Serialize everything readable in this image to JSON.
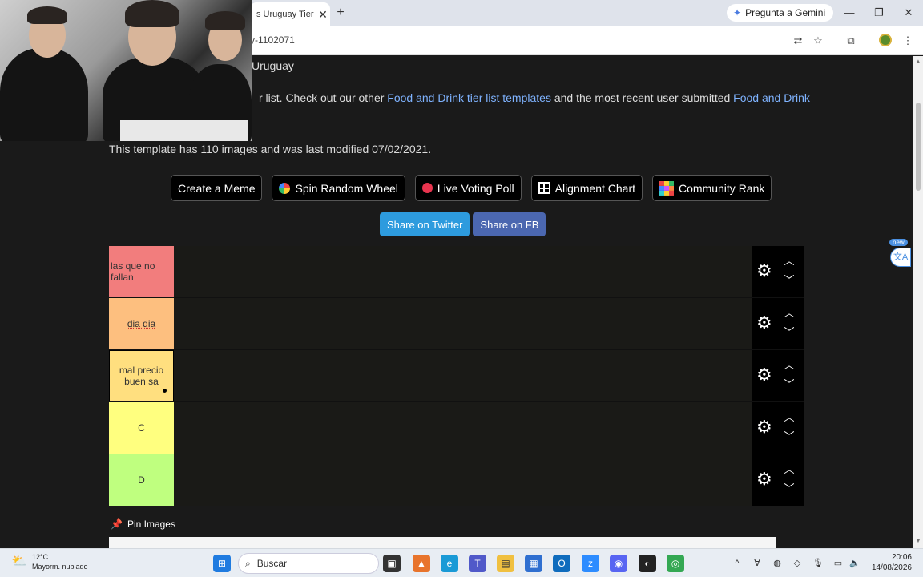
{
  "browser": {
    "tab_title": "s Uruguay Tier l",
    "tab_close": "✕",
    "new_tab": "+",
    "gemini_label": "Pregunta a Gemini",
    "url": "y-1102071",
    "window_controls": [
      "—",
      "❐",
      "✕"
    ]
  },
  "page": {
    "breadcrumb": "Uruguay",
    "desc_before": "r list. Check out our other ",
    "desc_link1": "Food and Drink tier list templates",
    "desc_middle": " and the most recent user submitted ",
    "desc_link2": "Food and Drink",
    "template_info": "This template has 110 images and was last modified 07/02/2021.",
    "buttons": [
      {
        "label": "Create a Meme",
        "icon": ""
      },
      {
        "label": "Spin Random Wheel",
        "icon": "wheel-icon"
      },
      {
        "label": "Live Voting Poll",
        "icon": "red-dot-icon"
      },
      {
        "label": "Alignment Chart",
        "icon": "grid-icon"
      },
      {
        "label": "Community Rank",
        "icon": "grid-colors-icon"
      }
    ],
    "share": {
      "twitter": "Share on Twitter",
      "fb": "Share on FB",
      "twitter_color": "#2d9bde",
      "fb_color": "#4b67b0"
    },
    "tiers": [
      {
        "label": "las que no fallan",
        "color": "#f27d7d"
      },
      {
        "label": "dia dia",
        "color": "#fdbf7f"
      },
      {
        "label": "mal precio buen sa",
        "color": "#ffdf7f"
      },
      {
        "label": "C",
        "color": "#ffff7f"
      },
      {
        "label": "D",
        "color": "#bfff7f"
      }
    ],
    "pin_images": "Pin Images",
    "new_badge": "new"
  },
  "taskbar": {
    "temp": "12°C",
    "weather": "Mayorm. nublado",
    "search_placeholder": "Buscar",
    "time": "20:06",
    "date": "14/08/2026"
  }
}
